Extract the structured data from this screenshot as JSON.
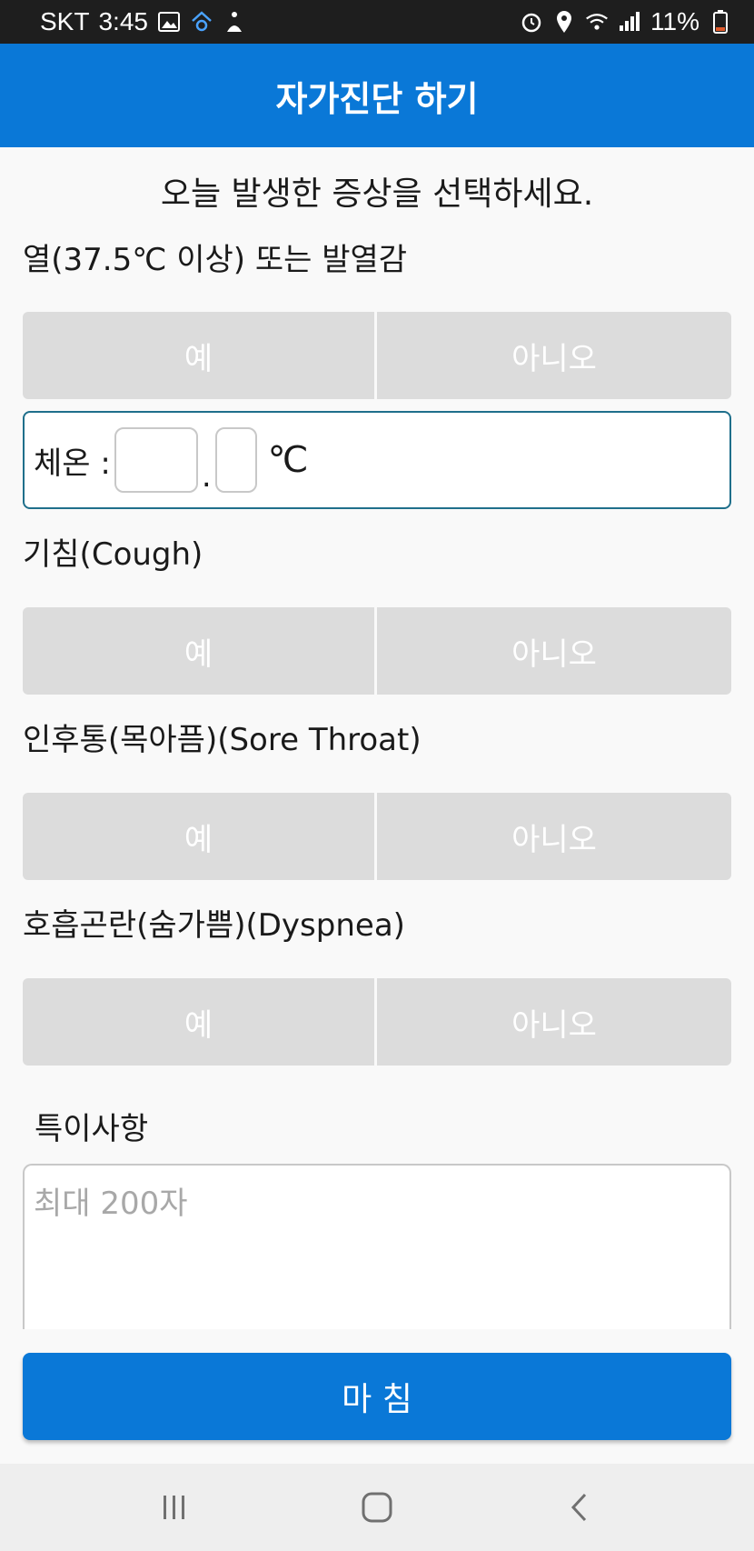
{
  "status_bar": {
    "carrier": "SKT",
    "time": "3:45",
    "battery": "11%",
    "icons_left": [
      "image-icon",
      "home-sync-icon",
      "accessibility-icon"
    ],
    "icons_right": [
      "alarm-icon",
      "location-icon",
      "wifi-icon",
      "signal-icon",
      "battery-icon"
    ]
  },
  "header": {
    "title": "자가진단 하기"
  },
  "instruction": "오늘 발생한 증상을 선택하세요.",
  "questions": [
    {
      "label": "열(37.5℃ 이상) 또는 발열감",
      "yes": "예",
      "no": "아니오"
    },
    {
      "label": "기침(Cough)",
      "yes": "예",
      "no": "아니오"
    },
    {
      "label": "인후통(목아픔)(Sore Throat)",
      "yes": "예",
      "no": "아니오"
    },
    {
      "label": "호흡곤란(숨가쁨)(Dyspnea)",
      "yes": "예",
      "no": "아니오"
    }
  ],
  "temperature": {
    "label": "체온 :",
    "dot": ".",
    "unit": "℃",
    "int_value": "",
    "dec_value": ""
  },
  "notes": {
    "label": "특이사항",
    "placeholder": "최대 200자",
    "value": ""
  },
  "finish_button": "마 침",
  "colors": {
    "primary": "#0a78d7",
    "button_gray": "#dcdcdc",
    "status_bar": "#1e1e1e",
    "temp_border": "#1f6f8b"
  }
}
